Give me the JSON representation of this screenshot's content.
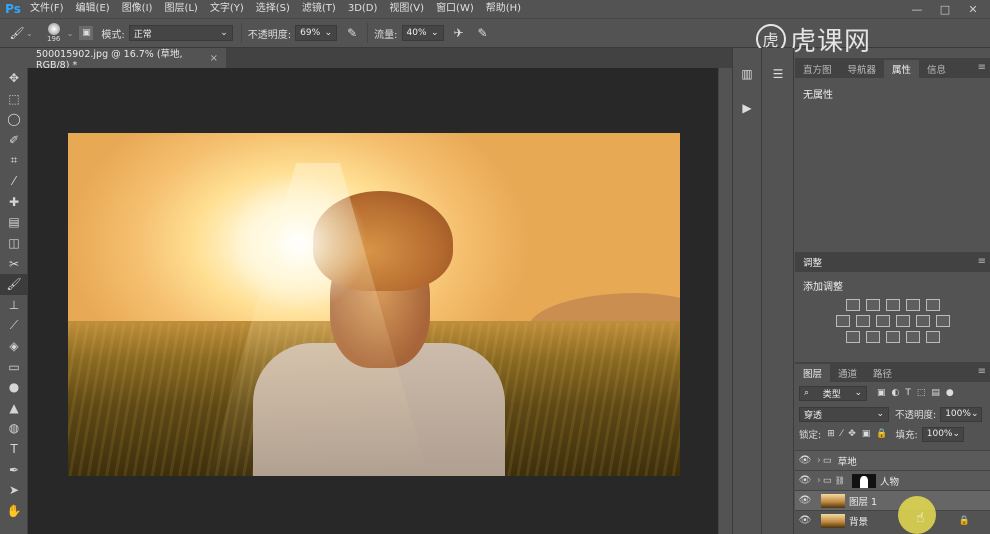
{
  "app": {
    "logo": "Ps"
  },
  "menu": [
    "文件(F)",
    "编辑(E)",
    "图像(I)",
    "图层(L)",
    "文字(Y)",
    "选择(S)",
    "滤镜(T)",
    "3D(D)",
    "视图(V)",
    "窗口(W)",
    "帮助(H)"
  ],
  "window_controls": {
    "minimize": "—",
    "maximize": "□",
    "close": "✕"
  },
  "options": {
    "brush_size": "196",
    "mode_label": "模式:",
    "mode_value": "正常",
    "opacity_label": "不透明度:",
    "opacity_value": "69%",
    "flow_label": "流量:",
    "flow_value": "40%"
  },
  "watermark": {
    "text": "虎课网"
  },
  "document_tab": {
    "title": "500015902.jpg @ 16.7% (草地, RGB/8) *",
    "close": "×"
  },
  "tools": [
    "move",
    "marquee",
    "lasso",
    "quick-select",
    "crop",
    "eyedropper",
    "healing",
    "brush-alt",
    "clone",
    "history",
    "eraser",
    "gradient",
    "blur",
    "dodge",
    "pen",
    "type",
    "path-select",
    "shape",
    "hand",
    "zoom"
  ],
  "properties_panel": {
    "tabs": [
      "直方图",
      "导航器",
      "属性",
      "信息"
    ],
    "active_tab": "属性",
    "content": "无属性"
  },
  "adjustments_panel": {
    "title": "调整",
    "add_label": "添加调整"
  },
  "layers_panel": {
    "tabs": [
      "图层",
      "通道",
      "路径"
    ],
    "filter_label": "类型",
    "blend_mode": "穿透",
    "opacity_label": "不透明度:",
    "opacity_value": "100%",
    "lock_label": "锁定:",
    "fill_label": "填充:",
    "fill_value": "100%",
    "layers": [
      {
        "name": "草地",
        "type": "group"
      },
      {
        "name": "人物",
        "type": "group-mask"
      },
      {
        "name": "图层 1",
        "type": "image"
      },
      {
        "name": "背景",
        "type": "background"
      }
    ]
  }
}
